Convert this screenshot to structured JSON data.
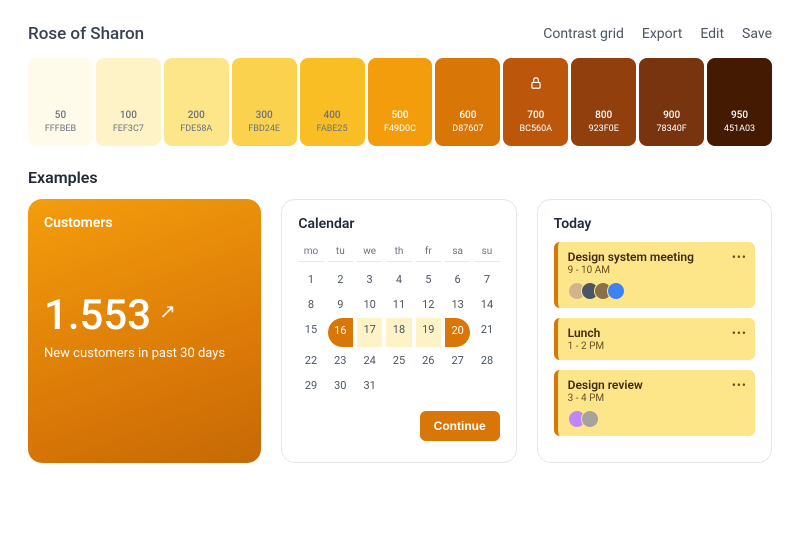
{
  "header": {
    "title": "Rose of Sharon",
    "actions": [
      "Contrast grid",
      "Export",
      "Edit",
      "Save"
    ]
  },
  "swatches": [
    {
      "shade": "50",
      "hex": "FFFBEB",
      "fg": "#6b7280",
      "locked": false
    },
    {
      "shade": "100",
      "hex": "FEF3C7",
      "fg": "#6b7280",
      "locked": false
    },
    {
      "shade": "200",
      "hex": "FDE58A",
      "fg": "#6b7280",
      "locked": false
    },
    {
      "shade": "300",
      "hex": "FBD24E",
      "fg": "#6b7280",
      "locked": false
    },
    {
      "shade": "400",
      "hex": "FABE25",
      "fg": "#6b7280",
      "locked": false
    },
    {
      "shade": "500",
      "hex": "F49D0C",
      "fg": "#ffffff",
      "locked": false
    },
    {
      "shade": "600",
      "hex": "D87607",
      "fg": "#ffffff",
      "locked": false
    },
    {
      "shade": "700",
      "hex": "BC560A",
      "fg": "#ffffff",
      "locked": true
    },
    {
      "shade": "800",
      "hex": "923F0E",
      "fg": "#ffffff",
      "locked": false
    },
    {
      "shade": "900",
      "hex": "78340F",
      "fg": "#ffffff",
      "locked": false
    },
    {
      "shade": "950",
      "hex": "451A03",
      "fg": "#ffffff",
      "locked": false
    }
  ],
  "examples_label": "Examples",
  "customers": {
    "title": "Customers",
    "value": "1.553",
    "trend_icon": "↗",
    "caption": "New customers in past 30 days"
  },
  "calendar": {
    "title": "Calendar",
    "dow": [
      "mo",
      "tu",
      "we",
      "th",
      "fr",
      "sa",
      "su"
    ],
    "days": [
      [
        1,
        2,
        3,
        4,
        5,
        6,
        7
      ],
      [
        8,
        9,
        10,
        11,
        12,
        13,
        14
      ],
      [
        15,
        16,
        17,
        18,
        19,
        20,
        21
      ],
      [
        22,
        23,
        24,
        25,
        26,
        27,
        28
      ],
      [
        29,
        30,
        31
      ]
    ],
    "range": {
      "start": 16,
      "end": 20
    },
    "continue_label": "Continue"
  },
  "today": {
    "title": "Today",
    "events": [
      {
        "title": "Design system meeting",
        "time": "9 - 10 AM",
        "avatars": [
          "#d1b48c",
          "#4b5563",
          "#8b6f47",
          "#3b82f6"
        ]
      },
      {
        "title": "Lunch",
        "time": "1 - 2 PM",
        "avatars": []
      },
      {
        "title": "Design review",
        "time": "3 - 4 PM",
        "avatars": [
          "#c084fc",
          "#a8a29e"
        ]
      }
    ]
  }
}
